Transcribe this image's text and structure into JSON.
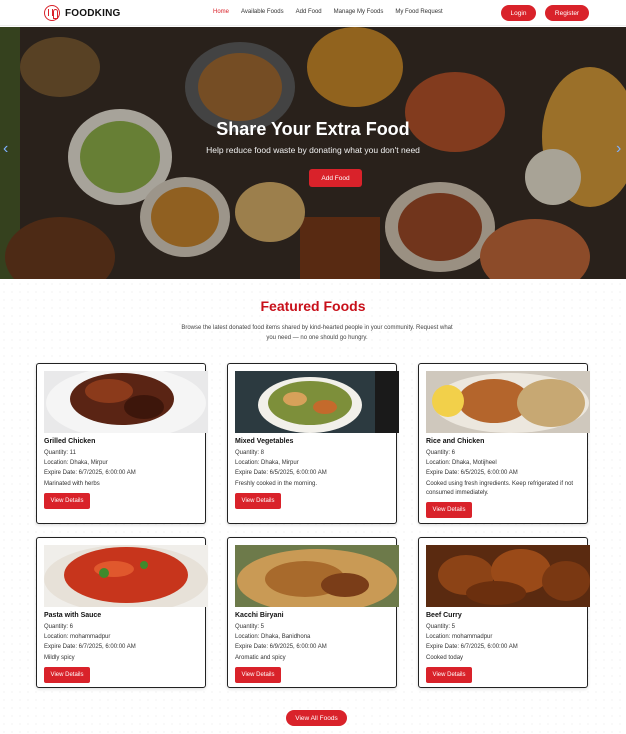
{
  "brand": {
    "name": "FOODKING"
  },
  "nav": {
    "items": [
      {
        "label": "Home",
        "active": true
      },
      {
        "label": "Available Foods"
      },
      {
        "label": "Add Food"
      },
      {
        "label": "Manage My Foods"
      },
      {
        "label": "My Food Request"
      }
    ],
    "login": "Login",
    "register": "Register"
  },
  "hero": {
    "title": "Share Your Extra Food",
    "subtitle": "Help reduce food waste by donating what you don't need",
    "button": "Add Food",
    "prev": "‹",
    "next": "›"
  },
  "featured": {
    "title": "Featured Foods",
    "description": "Browse the latest donated food items shared by kind-hearted people in your community. Request what you need — no one should go hungry."
  },
  "foods": [
    {
      "name": "Grilled Chicken",
      "quantity": "Quantity: 11",
      "location": "Location: Dhaka, Mirpur",
      "expire": "Expire Date: 6/7/2025, 6:00:00 AM",
      "note": "Marinated with herbs",
      "button": "View Details"
    },
    {
      "name": "Mixed Vegetables",
      "quantity": "Quantity: 8",
      "location": "Location: Dhaka, Mirpur",
      "expire": "Expire Date: 6/5/2025, 6:00:00 AM",
      "note": "Freshly cooked in the morning.",
      "button": "View Details"
    },
    {
      "name": "Rice and Chicken",
      "quantity": "Quantity: 6",
      "location": "Location: Dhaka, Motijheel",
      "expire": "Expire Date: 6/5/2025, 6:00:00 AM",
      "note": "Cooked using fresh ingredients. Keep refrigerated if not consumed immediately.",
      "button": "View Details"
    },
    {
      "name": "Pasta with Sauce",
      "quantity": "Quantity: 6",
      "location": "Location: mohammadpur",
      "expire": "Expire Date: 6/7/2025, 6:00:00 AM",
      "note": "Mildly spicy",
      "button": "View Details"
    },
    {
      "name": "Kacchi Biryani",
      "quantity": "Quantity: 5",
      "location": "Location: Dhaka, Banidhona",
      "expire": "Expire Date: 6/9/2025, 6:00:00 AM",
      "note": "Aromatic and spicy",
      "button": "View Details"
    },
    {
      "name": "Beef Curry",
      "quantity": "Quantity: 5",
      "location": "Location: mohammadpur",
      "expire": "Expire Date: 6/7/2025, 6:00:00 AM",
      "note": "Cooked today",
      "button": "View Details"
    }
  ],
  "view_all": "View All Foods",
  "colors": {
    "accent": "#d9222a",
    "title_red": "#c8101a"
  }
}
